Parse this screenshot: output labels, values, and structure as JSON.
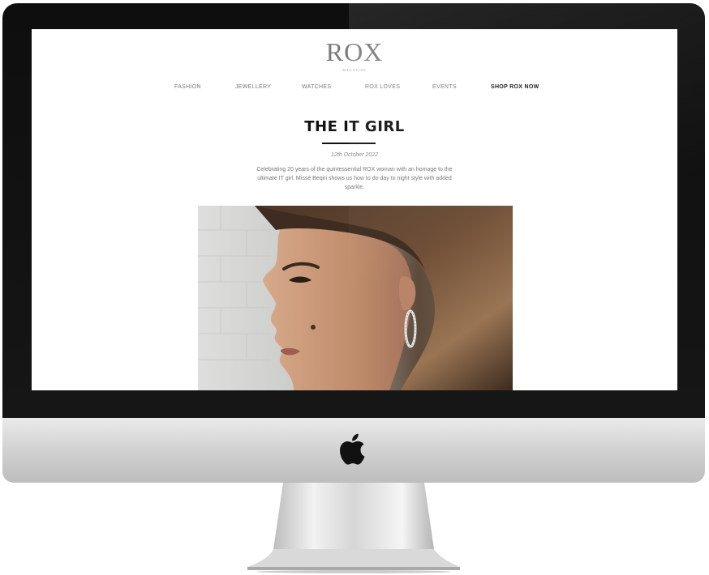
{
  "site": {
    "logo": "ROX",
    "logo_sub": "MAGAZINE"
  },
  "nav": {
    "items": [
      {
        "label": "FASHION"
      },
      {
        "label": "JEWELLERY"
      },
      {
        "label": "WATCHES"
      },
      {
        "label": "ROX LOVES"
      },
      {
        "label": "EVENTS"
      },
      {
        "label": "SHOP ROX NOW"
      }
    ]
  },
  "article": {
    "title": "THE IT GIRL",
    "date": "12th October 2022",
    "intro": "Celebrating 20 years of the quintessential ROX woman with an homage to the ultimate IT girl. Missé Beqiri shows us how to do day to night style with added sparkle."
  },
  "device": {
    "logo_icon": "apple-icon"
  }
}
